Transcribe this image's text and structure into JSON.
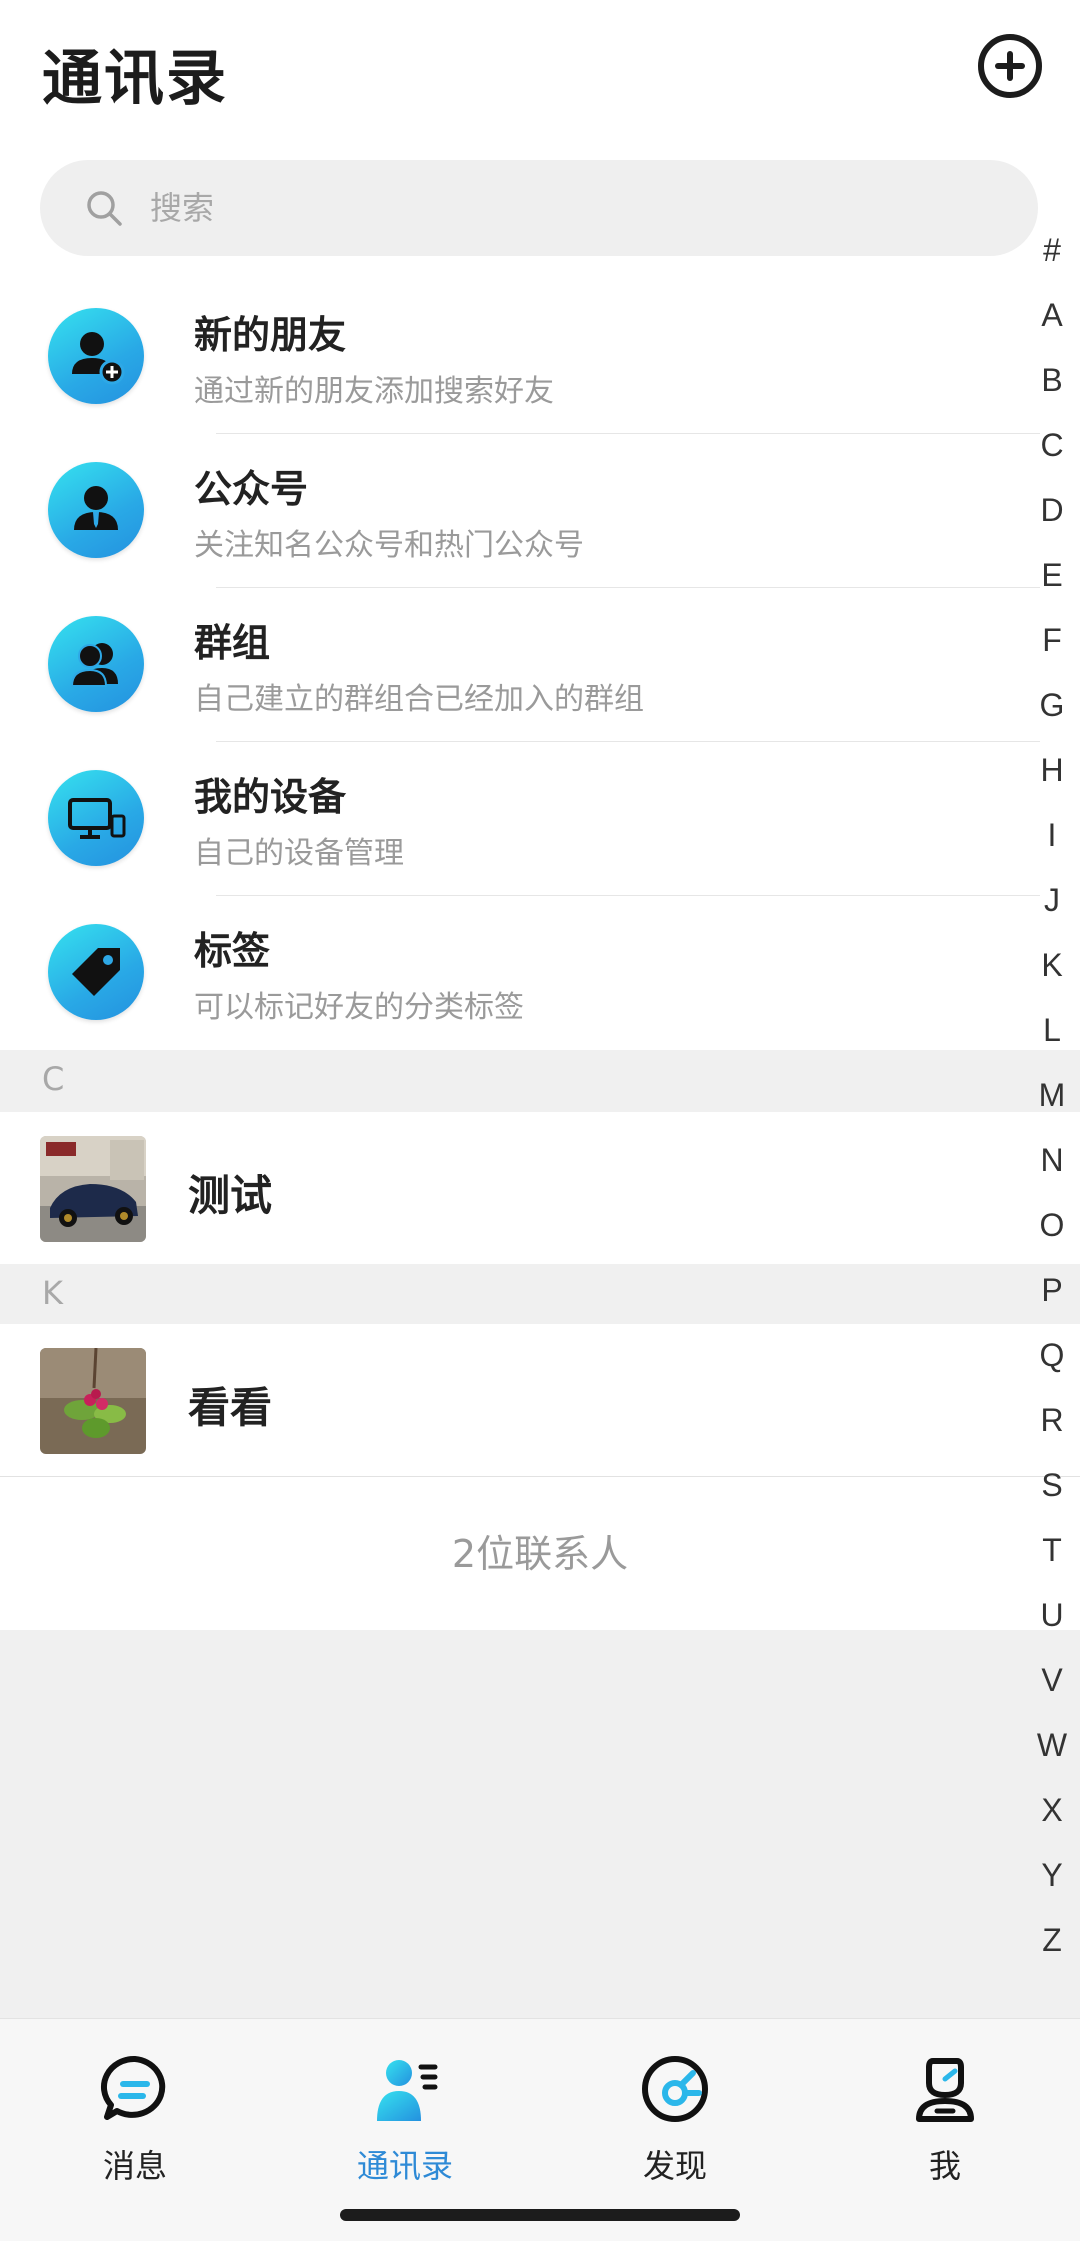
{
  "header": {
    "title": "通讯录"
  },
  "search": {
    "placeholder": "搜索"
  },
  "functions": [
    {
      "title": "新的朋友",
      "subtitle": "通过新的朋友添加搜索好友",
      "icon": "add-friend-icon"
    },
    {
      "title": "公众号",
      "subtitle": "关注知名公众号和热门公众号",
      "icon": "official-account-icon"
    },
    {
      "title": "群组",
      "subtitle": "自己建立的群组合已经加入的群组",
      "icon": "group-icon"
    },
    {
      "title": "我的设备",
      "subtitle": "自己的设备管理",
      "icon": "device-icon"
    },
    {
      "title": "标签",
      "subtitle": "可以标记好友的分类标签",
      "icon": "tag-icon"
    }
  ],
  "sections": [
    {
      "letter": "C",
      "contacts": [
        {
          "name": "测试",
          "avatar": "car-photo"
        }
      ]
    },
    {
      "letter": "K",
      "contacts": [
        {
          "name": "看看",
          "avatar": "flower-photo"
        }
      ]
    }
  ],
  "contact_count": "2位联系人",
  "alphabet": [
    "#",
    "A",
    "B",
    "C",
    "D",
    "E",
    "F",
    "G",
    "H",
    "I",
    "J",
    "K",
    "L",
    "M",
    "N",
    "O",
    "P",
    "Q",
    "R",
    "S",
    "T",
    "U",
    "V",
    "W",
    "X",
    "Y",
    "Z"
  ],
  "tabs": [
    {
      "label": "消息",
      "icon": "chat-icon",
      "active": false
    },
    {
      "label": "通讯录",
      "icon": "contacts-icon",
      "active": true
    },
    {
      "label": "发现",
      "icon": "discover-icon",
      "active": false
    },
    {
      "label": "我",
      "icon": "profile-icon",
      "active": false
    }
  ],
  "colors": {
    "accent": "#2e8ad6",
    "icon_gradient_start": "#36e2ef",
    "icon_gradient_end": "#2491df"
  }
}
